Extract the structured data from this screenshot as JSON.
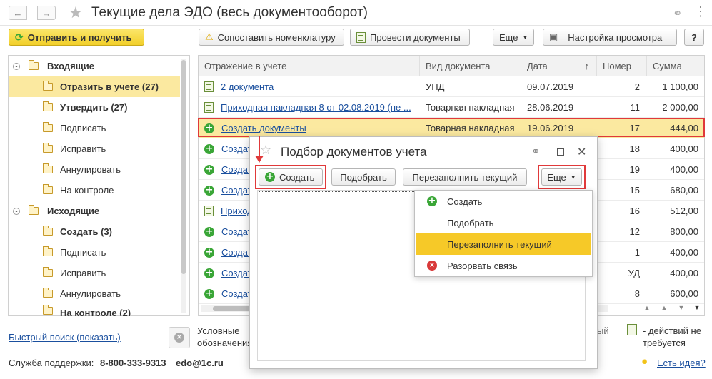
{
  "window": {
    "title": "Текущие дела ЭДО (весь документооборот)"
  },
  "toolbar": {
    "send_receive": "Отправить и получить",
    "match_nomenclature": "Сопоставить номенклатуру",
    "post_documents": "Провести документы",
    "more": "Еще",
    "view_settings": "Настройка просмотра",
    "help": "?"
  },
  "tree": {
    "incoming": {
      "label": "Входящие",
      "items": [
        {
          "label": "Отразить в учете (27)"
        },
        {
          "label": "Утвердить (27)"
        },
        {
          "label": "Подписать"
        },
        {
          "label": "Исправить"
        },
        {
          "label": "Аннулировать"
        },
        {
          "label": "На контроле"
        }
      ]
    },
    "outgoing": {
      "label": "Исходящие",
      "items": [
        {
          "label": "Создать (3)"
        },
        {
          "label": "Подписать"
        },
        {
          "label": "Исправить"
        },
        {
          "label": "Аннулировать"
        },
        {
          "label": "На контроле (2)"
        }
      ]
    }
  },
  "table": {
    "columns": [
      "Отражение в учете",
      "Вид документа",
      "Дата",
      "Номер",
      "Сумма"
    ],
    "sort_indicator": "↑",
    "rows": [
      {
        "reflection": "2 документа",
        "doc_type": "УПД",
        "date": "09.07.2019",
        "number": "2",
        "sum": "1 100,00"
      },
      {
        "reflection": "Приходная накладная 8 от 02.08.2019 (не ...",
        "doc_type": "Товарная накладная",
        "date": "28.06.2019",
        "number": "11",
        "sum": "2 000,00"
      },
      {
        "reflection": "Создать документы",
        "doc_type": "Товарная накладная",
        "date": "19.06.2019",
        "number": "17",
        "sum": "444,00"
      },
      {
        "reflection": "Создат",
        "number": "18",
        "sum": "400,00"
      },
      {
        "reflection": "Создат",
        "number": "19",
        "sum": "400,00"
      },
      {
        "reflection": "Создат",
        "number": "15",
        "sum": "680,00"
      },
      {
        "reflection": "Приход",
        "number": "16",
        "sum": "512,00"
      },
      {
        "reflection": "Создат",
        "number": "12",
        "sum": "800,00"
      },
      {
        "reflection": "Создат",
        "number": "1",
        "sum": "400,00"
      },
      {
        "reflection": "Создат",
        "number": "УД",
        "sum": "400,00"
      },
      {
        "reflection": "Создат",
        "number": "8",
        "sum": "600,00"
      }
    ]
  },
  "footer": {
    "quick_search": "Быстрый поиск (показать)",
    "legend_line1": "Условные",
    "legend_line2": "обозначения",
    "support_label": "Служба поддержки:",
    "support_phone": "8-800-333-9313",
    "support_email": "edo@1c.ru",
    "no_action_line1": "- действий не",
    "no_action_line2": "требуется",
    "partial_text": "ый",
    "ideas": "Есть идея?"
  },
  "dialog": {
    "title": "Подбор документов учета",
    "create": "Создать",
    "select": "Подобрать",
    "refill": "Перезаполнить текущий",
    "more": "Еще",
    "menu": [
      {
        "label": "Создать",
        "icon": "plus-icon"
      },
      {
        "label": "Подобрать",
        "icon": ""
      },
      {
        "label": "Перезаполнить текущий",
        "icon": ""
      },
      {
        "label": "Разорвать связь",
        "icon": "break-link-icon"
      }
    ]
  },
  "colors": {
    "accent_yellow": "#f6c928",
    "selection": "#fbe9a0",
    "highlight_red": "#e0393a",
    "link": "#1a4f9e"
  }
}
